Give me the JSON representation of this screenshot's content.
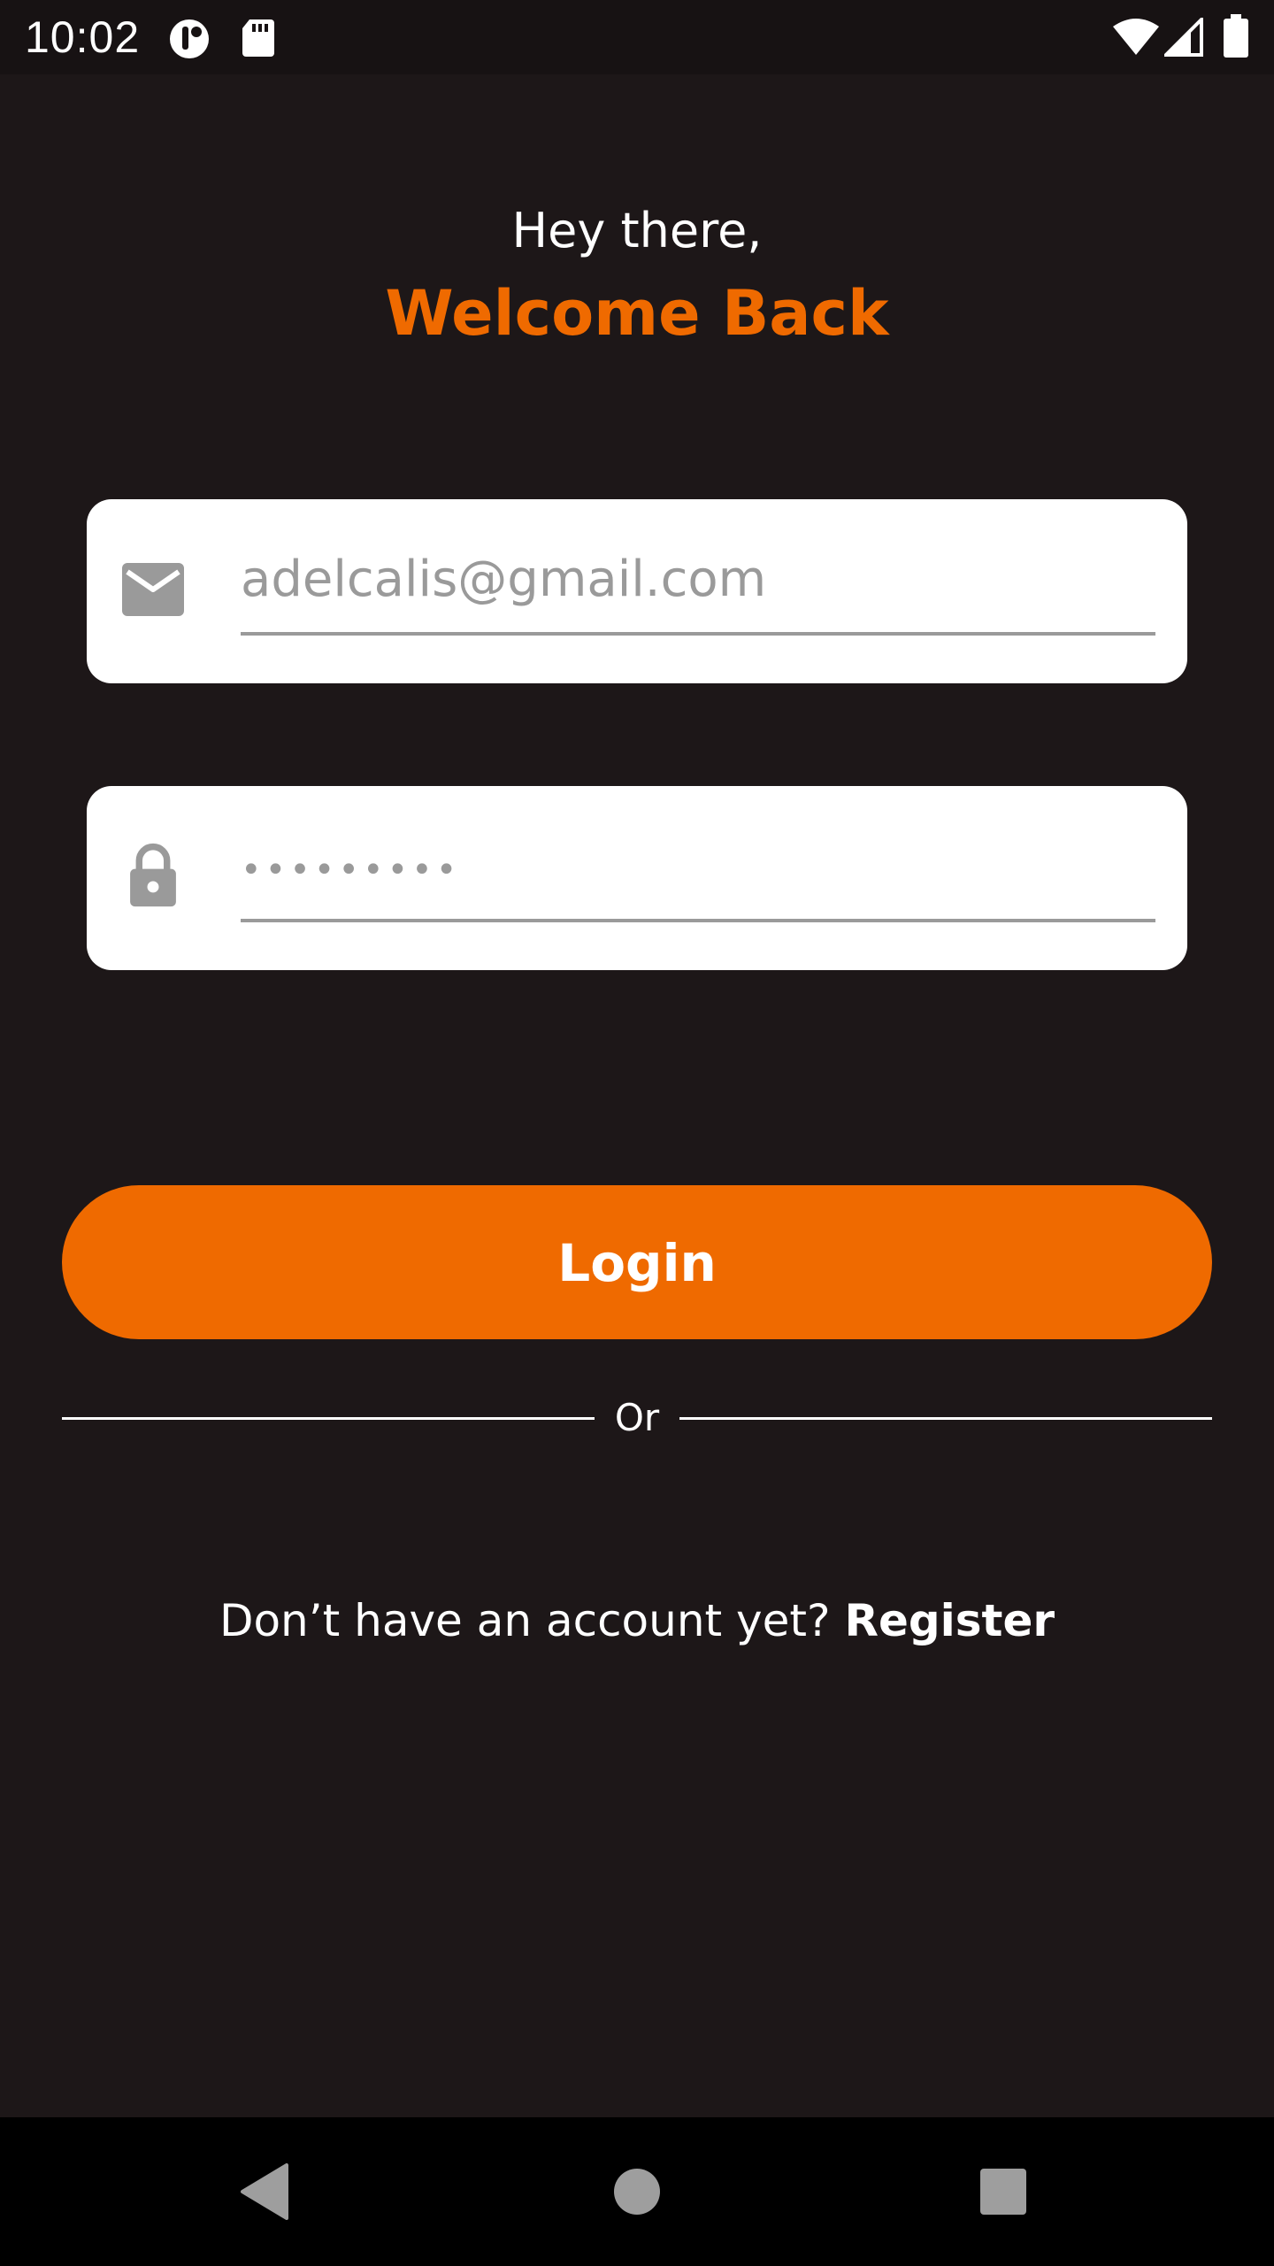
{
  "status_bar": {
    "time": "10:02",
    "icons_left": [
      "notification-app-icon",
      "sd-card-icon"
    ],
    "icons_right": [
      "wifi-icon",
      "signal-icon",
      "battery-icon"
    ]
  },
  "header": {
    "greeting": "Hey there,",
    "title": "Welcome Back"
  },
  "form": {
    "email": {
      "icon": "mail-icon",
      "placeholder": "adelcalis@gmail.com",
      "value": ""
    },
    "password": {
      "icon": "lock-icon",
      "masked_value": "•••••••••"
    },
    "login_label": "Login",
    "divider_text": "Or"
  },
  "register": {
    "prompt": "Don’t have an account yet?",
    "link_label": "Register"
  },
  "nav_bar": {
    "buttons": [
      "back-icon",
      "home-icon",
      "recents-icon"
    ]
  },
  "colors": {
    "background": "#1d1718",
    "accent": "#ef6a00",
    "card": "#ffffff",
    "muted": "#9a9a9a"
  }
}
